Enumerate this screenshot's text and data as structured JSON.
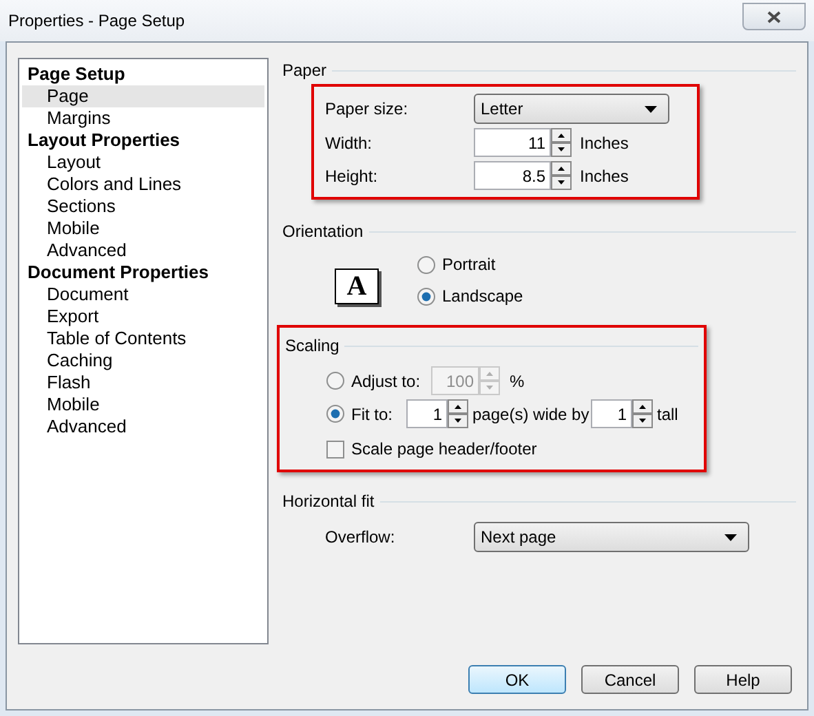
{
  "window": {
    "title": "Properties - Page Setup"
  },
  "tree": [
    {
      "label": "Page Setup",
      "selected": false,
      "children": [
        {
          "label": "Page",
          "selected": true
        },
        {
          "label": "Margins",
          "selected": false
        }
      ]
    },
    {
      "label": "Layout Properties",
      "selected": false,
      "children": [
        {
          "label": "Layout",
          "selected": false
        },
        {
          "label": "Colors and Lines",
          "selected": false
        },
        {
          "label": "Sections",
          "selected": false
        },
        {
          "label": "Mobile",
          "selected": false
        },
        {
          "label": "Advanced",
          "selected": false
        }
      ]
    },
    {
      "label": "Document Properties",
      "selected": false,
      "children": [
        {
          "label": "Document",
          "selected": false
        },
        {
          "label": "Export",
          "selected": false
        },
        {
          "label": "Table of Contents",
          "selected": false
        },
        {
          "label": "Caching",
          "selected": false
        },
        {
          "label": "Flash",
          "selected": false
        },
        {
          "label": "Mobile",
          "selected": false
        },
        {
          "label": "Advanced",
          "selected": false
        }
      ]
    }
  ],
  "paper": {
    "title": "Paper",
    "highlighted": true,
    "paper_size": {
      "label": "Paper size:",
      "value": "Letter"
    },
    "width": {
      "label": "Width:",
      "value": "11",
      "unit": "Inches"
    },
    "height": {
      "label": "Height:",
      "value": "8.5",
      "unit": "Inches"
    }
  },
  "orientation": {
    "title": "Orientation",
    "icon_letter": "A",
    "options": [
      {
        "label": "Portrait",
        "selected": false
      },
      {
        "label": "Landscape",
        "selected": true
      }
    ]
  },
  "scaling": {
    "title": "Scaling",
    "highlighted": true,
    "adjust_to": {
      "label": "Adjust to:",
      "selected": false,
      "value": "100",
      "unit": "%",
      "disabled": true
    },
    "fit_to": {
      "label": "Fit to:",
      "selected": true,
      "wide": "1",
      "wide_label": "page(s) wide by",
      "tall": "1",
      "tall_label": "tall"
    },
    "scale_header_footer": {
      "label": "Scale page header/footer",
      "checked": false
    }
  },
  "horizontal_fit": {
    "title": "Horizontal fit",
    "overflow": {
      "label": "Overflow:",
      "value": "Next page"
    }
  },
  "buttons": [
    {
      "label": "OK",
      "default": true
    },
    {
      "label": "Cancel",
      "default": false
    },
    {
      "label": "Help",
      "default": false
    }
  ]
}
